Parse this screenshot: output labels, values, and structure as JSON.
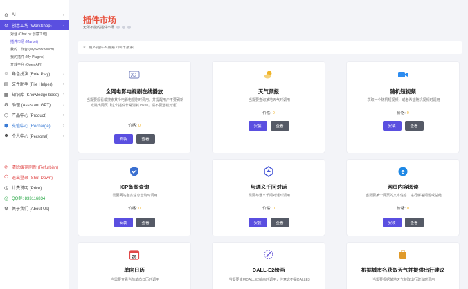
{
  "sidebar": {
    "items": [
      {
        "label": "AI",
        "icon": "⊙"
      },
      {
        "label": "创意工坊 (WorkShop)",
        "icon": "⊙"
      },
      {
        "label": "角色扮演 (Role Play)",
        "icon": "☺"
      },
      {
        "label": "文件助手 (File Helper)",
        "icon": "▤"
      },
      {
        "label": "知识库 (Knowledge base)",
        "icon": "▦"
      },
      {
        "label": "助理 (Assistant GPT)",
        "icon": "⚙"
      },
      {
        "label": "产品中心 (Product)",
        "icon": "⬡"
      },
      {
        "label": "充值中心 (Recharge)",
        "icon": "⬢"
      },
      {
        "label": "个人中心 (Personal)",
        "icon": "☻"
      }
    ],
    "sub_items": [
      {
        "label": "对话 (Chat by 创意工坊)"
      },
      {
        "label": "插件市场 (Market)"
      },
      {
        "label": "我的工作台 (My Workbench)"
      },
      {
        "label": "我的插件 (My Plugins)"
      },
      {
        "label": "开放平台 (Open API)"
      }
    ],
    "bottom": [
      {
        "label": "清除缓存刷新 (Refurbish)",
        "icon": "⟳"
      },
      {
        "label": "退出登录 (Shut Down)",
        "icon": "⏻"
      },
      {
        "label": "计费说明 (Price)",
        "icon": "◷"
      },
      {
        "label": "QQ群: 833116834",
        "icon": "◎"
      },
      {
        "label": "关于我们 (About Us)",
        "icon": "⚙"
      }
    ]
  },
  "header": {
    "title": "插件市场",
    "subtitle": "无所不能的插件市场"
  },
  "search": {
    "placeholder": "输入插件名搜索 / 回车搜索"
  },
  "cards": [
    {
      "title": "全网电影电视剧在线播放",
      "desc": "当需要观看或搜索某个电影电视剧时调用。并提醒用户不要刷新或跳出网页【这个插件非常消耗Token。请不要选错对话】",
      "price_label": "价格:",
      "price": "0",
      "install": "安装",
      "view": "查看",
      "icon": "film-icon",
      "color": "#8a94c8"
    },
    {
      "title": "天气预报",
      "desc": "当需要查询某地天气时调用",
      "price_label": "价格:",
      "price": "0",
      "install": "安装",
      "view": "查看",
      "icon": "weather-icon",
      "color": "#f0b429"
    },
    {
      "title": "随机短视频",
      "desc": "获取一个随机短视频，或者希望随机视频时调用",
      "price_label": "价格:",
      "price": "0",
      "install": "安装",
      "view": "查看",
      "icon": "video-icon",
      "color": "#2d8cf0"
    },
    {
      "title": "ICP备案查询",
      "desc": "需要网站备案信息查询时调用",
      "price_label": "价格:",
      "price": "0",
      "install": "安装",
      "view": "查看",
      "icon": "shield-icon",
      "color": "#3a6fd0"
    },
    {
      "title": "与通义千问对话",
      "desc": "需要与通义千问对话时调用",
      "price_label": "价格:",
      "price": "0",
      "install": "安装",
      "view": "查看",
      "icon": "tongyi-icon",
      "color": "#4a5ad8"
    },
    {
      "title": "网页内容阅读",
      "desc": "当需要某个网页的文本信息、进行解答问题或总结",
      "price_label": "价格:",
      "price": "0",
      "install": "安装",
      "view": "查看",
      "icon": "browser-icon",
      "color": "#1e88e5"
    },
    {
      "title": "单向日历",
      "desc": "当需要查看当前单向日历时调用",
      "icon": "calendar-icon",
      "color": "#e04848",
      "badge": "25"
    },
    {
      "title": "DALL-E2绘画",
      "desc": "当需要使用DALLE2绘画时调用，注意这不是DALLE3",
      "icon": "dalle-icon",
      "color": "#6a5ad8"
    },
    {
      "title": "根据城市名获取天气并提供出行建议",
      "desc": "当需要根据某地天气获取出行建议时调用",
      "icon": "luggage-icon",
      "color": "#e09a2a"
    }
  ]
}
